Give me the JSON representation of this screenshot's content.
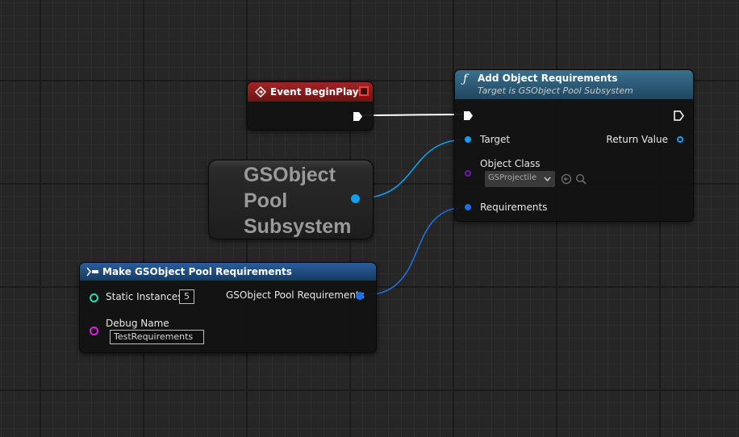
{
  "colors": {
    "event_header": "#8b1a1a",
    "function_header": "#2a5a78",
    "struct_header": "#1f4f82",
    "exec_wire": "#ffffff",
    "object_pin": "#10a0f0",
    "struct_pin": "#1e6fe0",
    "class_pin": "#6a1bb0",
    "int_pin": "#1fe0b0",
    "string_pin": "#e01fe0"
  },
  "event_node": {
    "icon": "event-diamond-icon",
    "title": "Event BeginPlay"
  },
  "function_node": {
    "icon": "function-f-icon",
    "title": "Add Object Requirements",
    "subtitle": "Target is GSObject Pool Subsystem",
    "pins": {
      "target": "Target",
      "return_value": "Return Value",
      "object_class": "Object Class",
      "object_class_value": "GSProjectile",
      "requirements": "Requirements"
    }
  },
  "subsystem_node": {
    "line1": "GSObject",
    "line2": "Pool",
    "line3": "Subsystem"
  },
  "make_node": {
    "icon": "make-struct-icon",
    "title": "Make GSObject Pool Requirements",
    "pins": {
      "static_instances": "Static Instances",
      "static_instances_value": "5",
      "output": "GSObject Pool Requirements",
      "debug_name": "Debug Name",
      "debug_name_value": "TestRequirements"
    }
  }
}
